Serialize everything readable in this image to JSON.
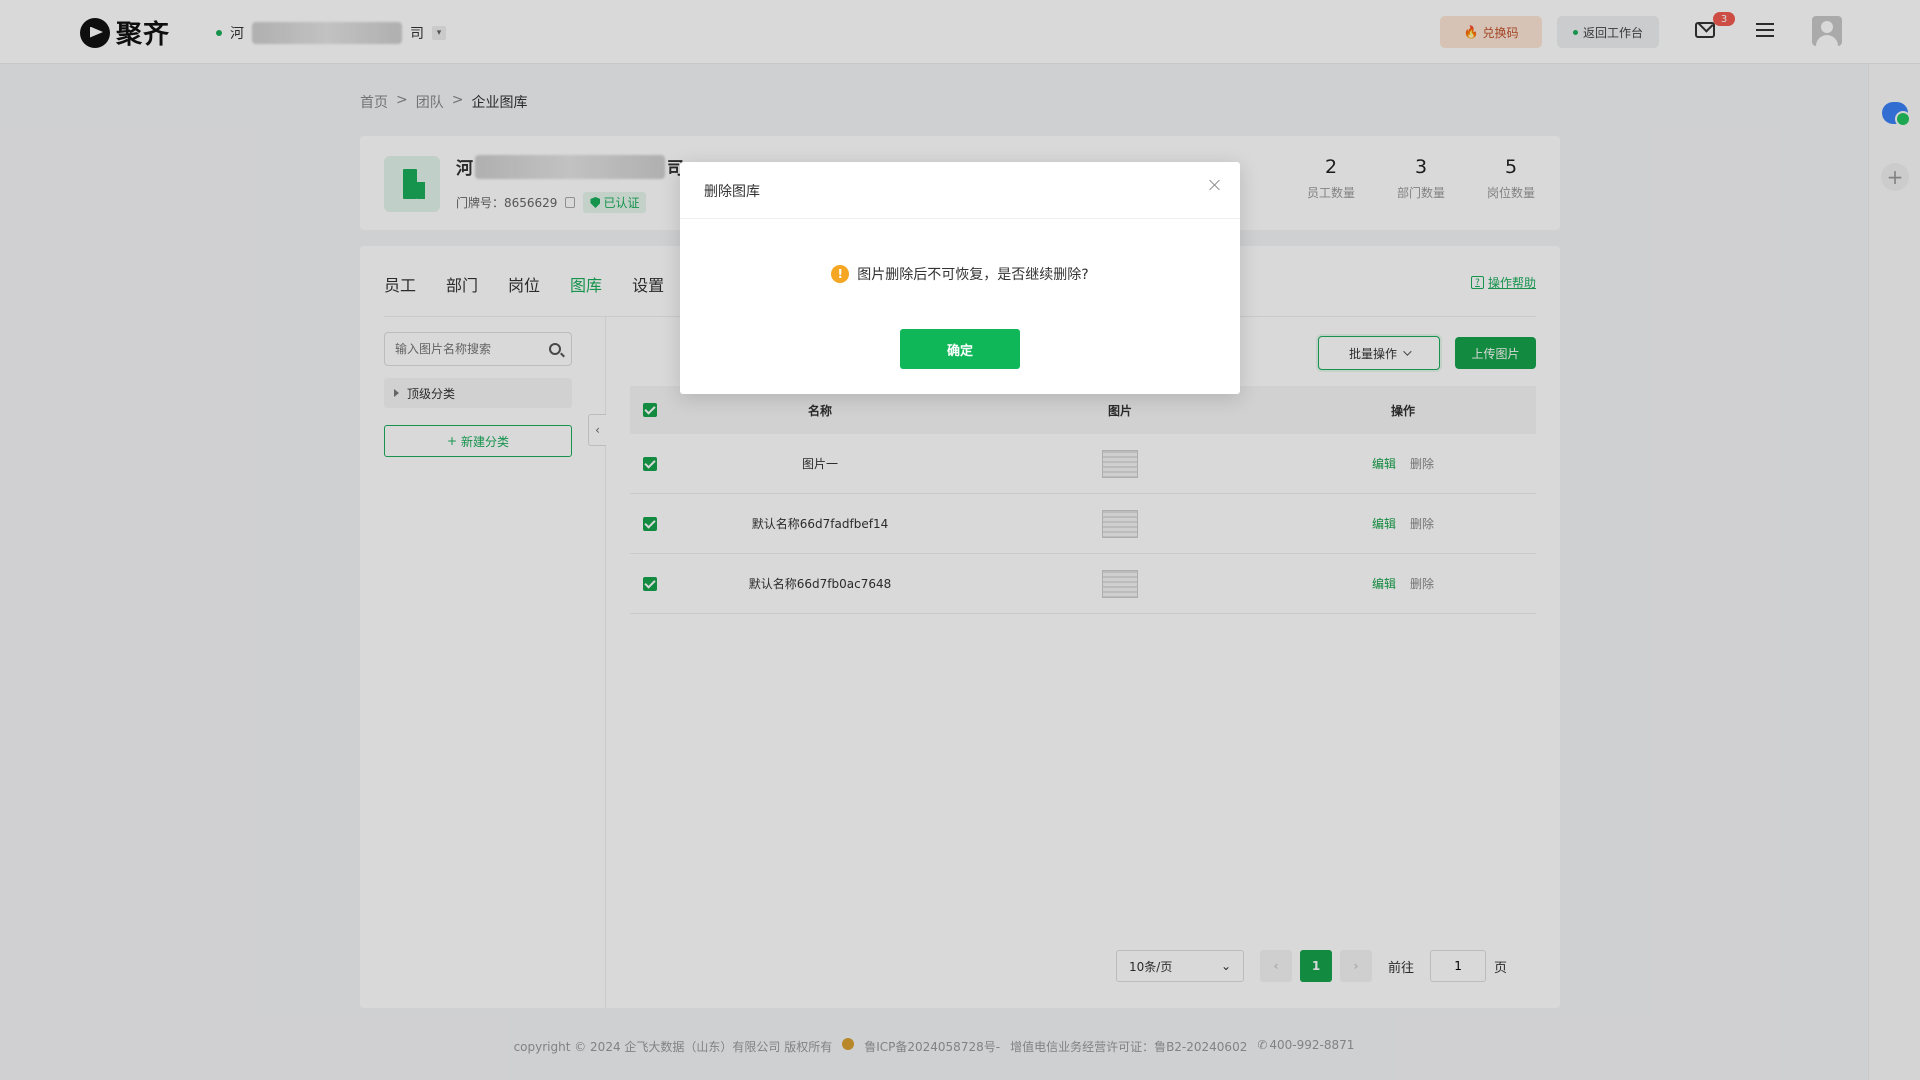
{
  "brand": {
    "name": "聚齐"
  },
  "header": {
    "company_prefix": "河",
    "company_suffix": "司",
    "redeem_label": "兑换码",
    "workbench_label": "返回工作台",
    "mail_badge": "3"
  },
  "breadcrumb": {
    "home": "首页",
    "sep1": ">",
    "team": "团队",
    "sep2": ">",
    "current": "企业图库"
  },
  "company": {
    "name_prefix": "河",
    "name_suffix": "司",
    "door_label": "门牌号：8656629",
    "verified_label": "已认证"
  },
  "stats": [
    {
      "value": "2",
      "label": "员工数量"
    },
    {
      "value": "3",
      "label": "部门数量"
    },
    {
      "value": "5",
      "label": "岗位数量"
    }
  ],
  "tabs": [
    {
      "label": "员工"
    },
    {
      "label": "部门"
    },
    {
      "label": "岗位"
    },
    {
      "label": "图库"
    },
    {
      "label": "设置"
    }
  ],
  "help_label": "操作帮助",
  "help_icon_glyph": "?",
  "sidebar": {
    "search_placeholder": "输入图片名称搜索",
    "tree_root": "顶级分类",
    "new_category": "新建分类",
    "plus_glyph": "+",
    "collapse_glyph": "‹"
  },
  "toolbar": {
    "batch_label": "批量操作",
    "upload_label": "上传图片"
  },
  "table": {
    "headers": {
      "name": "名称",
      "image": "图片",
      "ops": "操作"
    },
    "rows": [
      {
        "name": "图片一",
        "edit": "编辑",
        "delete": "删除"
      },
      {
        "name": "默认名称66d7fadfbef14",
        "edit": "编辑",
        "delete": "删除"
      },
      {
        "name": "默认名称66d7fb0ac7648",
        "edit": "编辑",
        "delete": "删除"
      }
    ]
  },
  "pager": {
    "page_size": "10条/页",
    "prev_glyph": "‹",
    "current": "1",
    "next_glyph": "›",
    "goto_label": "前往",
    "goto_value": "1",
    "page_unit": "页",
    "size_caret": "⌄"
  },
  "footer": {
    "copyright": "copyright © 2024 企飞大数据（山东）有限公司 版权所有",
    "icp": "鲁ICP备2024058728号-",
    "license": "增值电信业务经营许可证：鲁B2-20240602",
    "phone": "400-992-8871"
  },
  "modal": {
    "title": "删除图库",
    "message": "图片删除后不可恢复，是否继续删除?",
    "confirm_label": "确定",
    "warn_glyph": "!"
  },
  "colors": {
    "primary": "#16a34a",
    "warning": "#f5a623",
    "badge": "#f15b50"
  }
}
